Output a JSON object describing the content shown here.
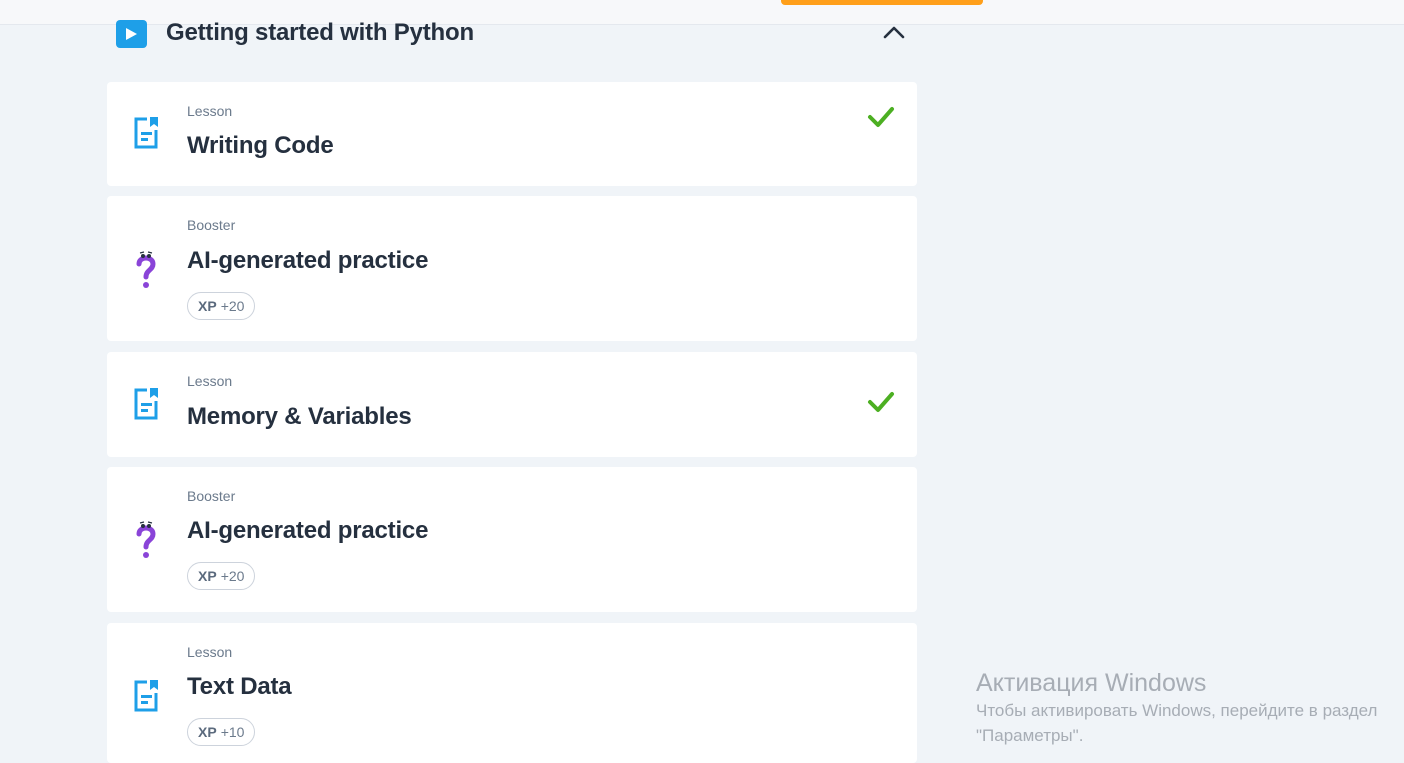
{
  "section": {
    "title": "Getting started with Python"
  },
  "items": [
    {
      "type": "Lesson",
      "title": "Writing Code",
      "completed": true
    },
    {
      "type": "Booster",
      "title": "AI-generated practice",
      "xp_label": "XP",
      "xp_value": "+20",
      "completed": false
    },
    {
      "type": "Lesson",
      "title": "Memory & Variables",
      "completed": true
    },
    {
      "type": "Booster",
      "title": "AI-generated practice",
      "xp_label": "XP",
      "xp_value": "+20",
      "completed": false
    },
    {
      "type": "Lesson",
      "title": "Text Data",
      "xp_label": "XP",
      "xp_value": "+10",
      "completed": false
    }
  ],
  "windows_activation": {
    "title": "Активация Windows",
    "line1": "Чтобы активировать Windows, перейдите в раздел",
    "line2": "\"Параметры\"."
  },
  "colors": {
    "accent_blue": "#1e9fe8",
    "check_green": "#4caf22",
    "booster_purple": "#8a44d8",
    "top_button_orange": "#ff9f1a"
  },
  "icons": {
    "section": "play-icon",
    "collapse": "chevron-up-icon",
    "lesson": "lesson-document-icon",
    "booster": "booster-question-icon",
    "completed": "check-icon"
  }
}
